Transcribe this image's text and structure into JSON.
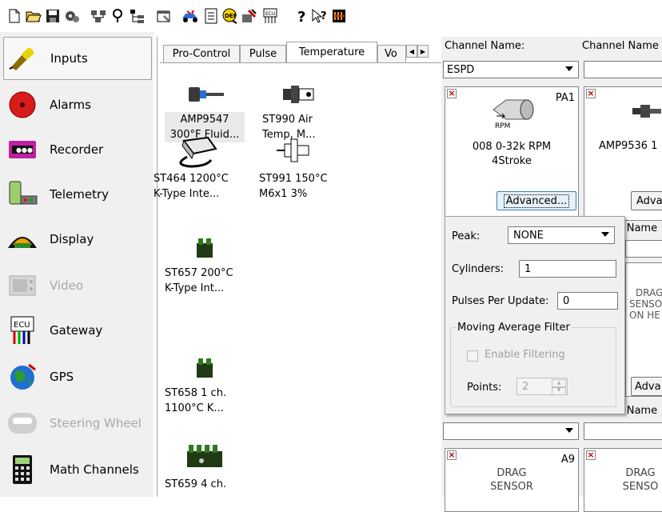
{
  "toolbar": {
    "icons": [
      "new-icon",
      "open-icon",
      "save-icon",
      "settings-icon",
      "network-icon",
      "find-icon",
      "tree-icon",
      "properties-icon",
      "vehicle-icon",
      "report-icon",
      "def-icon",
      "tools-icon",
      "ecu-icon",
      "help-icon",
      "context-help-icon",
      "about-icon"
    ]
  },
  "nav": {
    "items": [
      {
        "label": "Inputs",
        "icon": "inputs-icon",
        "selected": true
      },
      {
        "label": "Alarms",
        "icon": "alarm-bell-icon"
      },
      {
        "label": "Recorder",
        "icon": "recorder-icon"
      },
      {
        "label": "Telemetry",
        "icon": "telemetry-icon"
      },
      {
        "label": "Display",
        "icon": "display-icon"
      },
      {
        "label": "Video",
        "icon": "video-icon",
        "disabled": true
      },
      {
        "label": "Gateway",
        "icon": "ecu-gateway-icon"
      },
      {
        "label": "GPS",
        "icon": "gps-globe-icon"
      },
      {
        "label": "Steering Wheel",
        "icon": "steering-wheel-icon",
        "disabled": true
      },
      {
        "label": "Math Channels",
        "icon": "calculator-icon"
      }
    ]
  },
  "library": {
    "tabs": [
      "Pro-Control",
      "Pulse",
      "Temperature",
      "Vo"
    ],
    "active_tab": "Temperature",
    "sensors": [
      {
        "line1": "AMP9547",
        "line2": "300°F Fluid...",
        "icon": "fluid-temp-sensor-icon"
      },
      {
        "line1": "ST990 Air",
        "line2": "Temp, M...",
        "icon": "air-temp-sensor-icon"
      },
      {
        "line1": "ST464 1200°C",
        "line2": "K-Type Inte...",
        "icon": "k-type-sensor-icon"
      },
      {
        "line1": "ST991 150°C",
        "line2": "M6x1 3%",
        "icon": "probe-sensor-icon"
      },
      {
        "line1": "ST657 200°C",
        "line2": "K-Type Int...",
        "icon": "module-sensor-icon"
      },
      {
        "line1": "ST658 1 ch.",
        "line2": "1100°C K...",
        "icon": "module-sensor-icon"
      },
      {
        "line1": "ST659 4 ch.",
        "line2": "",
        "icon": "multi-module-sensor-icon"
      }
    ]
  },
  "channels": {
    "name_label": "Channel Name:",
    "name_label_2": "Channel Name",
    "name_value": "ESPD",
    "card1": {
      "pin": "PA1",
      "rpm_label": "RPM",
      "line1": "008 0-32k RPM",
      "line2": "4Stroke",
      "button": "Advanced..."
    },
    "card2": {
      "line1": "AMP9536 1",
      "button": "Adva"
    },
    "partial_name_label": "l Name",
    "drag_card": {
      "line1": "DRAG",
      "line2": "SENSO",
      "line3": "ON HE"
    },
    "bottom_card1": {
      "pin": "A9",
      "line1": "DRAG",
      "line2": "SENSOR"
    },
    "bottom_card2": {
      "line1": "DRAG",
      "line2": "SENSO"
    },
    "partial_button_2": "Adva",
    "partial_name_label_2": "l Name"
  },
  "popup": {
    "peak_label": "Peak:",
    "peak_value": "NONE",
    "cylinders_label": "Cylinders:",
    "cylinders_value": "1",
    "pulses_label": "Pulses Per Update:",
    "pulses_value": "0",
    "group_title": "Moving Average Filter",
    "enable_label": "Enable Filtering",
    "enable_checked": false,
    "points_label": "Points:",
    "points_value": "2"
  }
}
